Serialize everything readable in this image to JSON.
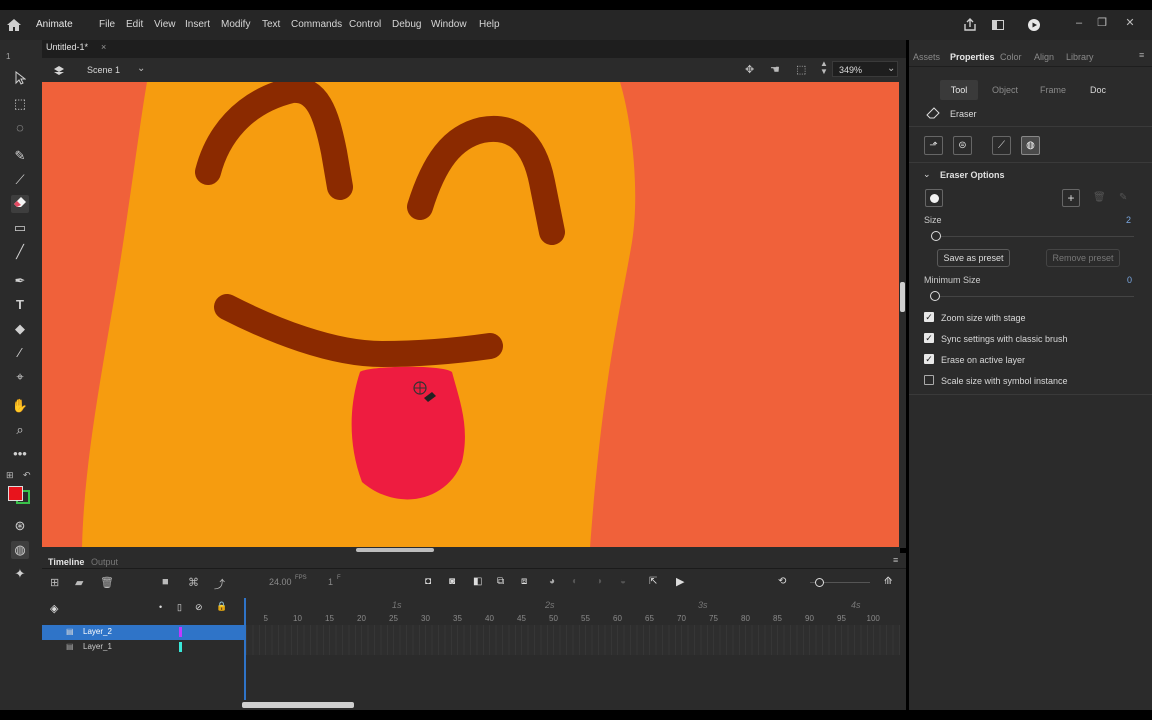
{
  "menubar": {
    "app_name": "Animate",
    "items": [
      "File",
      "Edit",
      "View",
      "Insert",
      "Modify",
      "Text",
      "Commands",
      "Control",
      "Debug",
      "Window",
      "Help"
    ]
  },
  "document": {
    "tab_title": "Untitled-1*",
    "close_glyph": "×"
  },
  "scene": {
    "name": "Scene 1",
    "zoom": "349%"
  },
  "timeline": {
    "tabs": [
      "Timeline",
      "Output"
    ],
    "fps_value": "24.00",
    "fps_unit": "FPS",
    "frame_value": "1",
    "frame_unit": "F",
    "seconds": [
      "1s",
      "2s",
      "3s",
      "4s"
    ],
    "frame_ticks": [
      "5",
      "10",
      "15",
      "20",
      "25",
      "30",
      "35",
      "40",
      "45",
      "50",
      "55",
      "60",
      "65",
      "70",
      "75",
      "80",
      "85",
      "90",
      "95",
      "100"
    ],
    "layers": [
      {
        "name": "Layer_2",
        "color": "#c039ff",
        "selected": true
      },
      {
        "name": "Layer_1",
        "color": "#39e7d8",
        "selected": false
      }
    ]
  },
  "panel": {
    "tabs": [
      "Assets",
      "Properties",
      "Color",
      "Align",
      "Library"
    ],
    "active_tab": "Properties",
    "subtabs": [
      "Tool",
      "Object",
      "Frame",
      "Doc"
    ],
    "active_subtab": "Tool",
    "tool_name": "Eraser",
    "options_title": "Eraser Options",
    "size_label": "Size",
    "size_value": "2",
    "save_preset": "Save as preset",
    "remove_preset": "Remove preset",
    "min_size_label": "Minimum Size",
    "min_size_value": "0",
    "checkboxes": [
      {
        "label": "Zoom size with stage",
        "checked": true
      },
      {
        "label": "Sync settings with classic brush",
        "checked": true
      },
      {
        "label": "Erase on active layer",
        "checked": true
      },
      {
        "label": "Scale size with symbol instance",
        "checked": false
      }
    ]
  },
  "colors": {
    "stage_bg": "#f0613a",
    "shape_fill": "#f69c0f",
    "stroke": "#8b2a00",
    "tongue": "#ee1c40",
    "accent": "#2f74c8",
    "fill_swatch": "#e8141c"
  }
}
